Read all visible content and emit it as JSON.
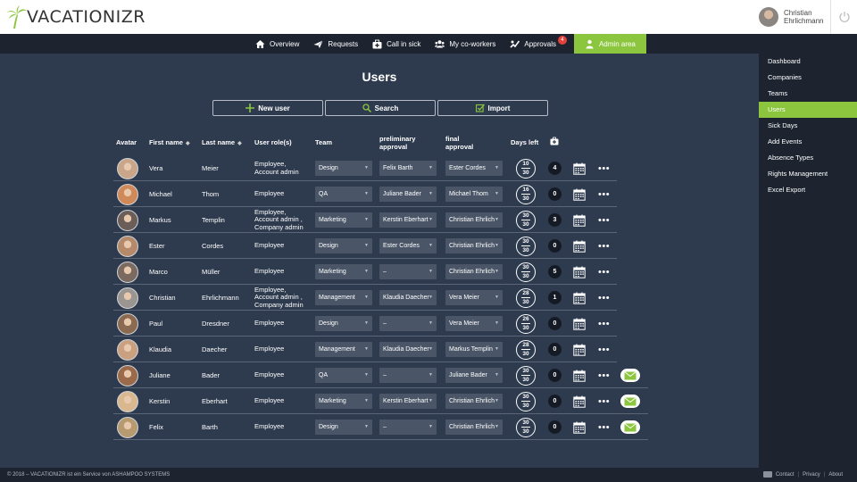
{
  "app": {
    "logo_text": "VACATIONIZR"
  },
  "user": {
    "name_line1": "Christian",
    "name_line2": "Ehrlichmann"
  },
  "nav": {
    "items": [
      {
        "label": "Overview",
        "icon": "home-icon"
      },
      {
        "label": "Requests",
        "icon": "plane-icon"
      },
      {
        "label": "Call in sick",
        "icon": "medkit-icon"
      },
      {
        "label": "My co-workers",
        "icon": "users-icon"
      },
      {
        "label": "Approvals",
        "icon": "approvals-icon",
        "badge": "4"
      },
      {
        "label": "Admin area",
        "icon": "admin-icon",
        "active": true
      }
    ]
  },
  "sidebar": {
    "items": [
      {
        "label": "Dashboard"
      },
      {
        "label": "Companies"
      },
      {
        "label": "Teams"
      },
      {
        "label": "Users",
        "active": true
      },
      {
        "label": "Sick Days"
      },
      {
        "label": "Add Events"
      },
      {
        "label": "Absence Types"
      },
      {
        "label": "Rights Management"
      },
      {
        "label": "Excel Export"
      }
    ]
  },
  "main": {
    "title": "Users",
    "actions": {
      "new_user": "New user",
      "search": "Search",
      "import": "Import"
    }
  },
  "table": {
    "headers": {
      "avatar": "Avatar",
      "first_name": "First name",
      "last_name": "Last name",
      "roles": "User role(s)",
      "team": "Team",
      "preliminary_1": "preliminary",
      "preliminary_2": "approval",
      "final_1": "final",
      "final_2": "approval",
      "days_left": "Days left"
    },
    "rows": [
      {
        "first": "Vera",
        "last": "Meier",
        "roles": [
          "Employee,",
          "Account admin"
        ],
        "team": "Design",
        "prelim": "Felix Barth",
        "final": "Ester Cordes",
        "days_left": "10",
        "days_total": "30",
        "sick": "4",
        "mail": false,
        "avatar_color": "#c9a58a"
      },
      {
        "first": "Michael",
        "last": "Thom",
        "roles": [
          "Employee"
        ],
        "team": "QA",
        "prelim": "Juliane Bader",
        "final": "Michael Thom",
        "days_left": "16",
        "days_total": "30",
        "sick": "0",
        "mail": false,
        "avatar_color": "#d08a5a"
      },
      {
        "first": "Markus",
        "last": "Templin",
        "roles": [
          "Employee,",
          "Account admin ,",
          "Company admin"
        ],
        "team": "Marketing",
        "prelim": "Kerstin Eberhart",
        "final": "Christian Ehrlich",
        "days_left": "30",
        "days_total": "30",
        "sick": "3",
        "mail": false,
        "avatar_color": "#6b5e58"
      },
      {
        "first": "Ester",
        "last": "Cordes",
        "roles": [
          "Employee"
        ],
        "team": "Design",
        "prelim": "Ester Cordes",
        "final": "Christian Ehrlich",
        "days_left": "30",
        "days_total": "30",
        "sick": "0",
        "mail": false,
        "avatar_color": "#b58a6a"
      },
      {
        "first": "Marco",
        "last": "Müller",
        "roles": [
          "Employee"
        ],
        "team": "Marketing",
        "prelim": "–",
        "final": "Christian Ehrlich",
        "days_left": "30",
        "days_total": "30",
        "sick": "5",
        "mail": false,
        "avatar_color": "#7a6a60"
      },
      {
        "first": "Christian",
        "last": "Ehrlichmann",
        "roles": [
          "Employee,",
          "Account admin ,",
          "Company admin"
        ],
        "team": "Management",
        "prelim": "Klaudia Daecher",
        "final": "Vera Meier",
        "days_left": "28",
        "days_total": "30",
        "sick": "1",
        "mail": false,
        "avatar_color": "#9a9590"
      },
      {
        "first": "Paul",
        "last": "Dresdner",
        "roles": [
          "Employee"
        ],
        "team": "Design",
        "prelim": "–",
        "final": "Vera Meier",
        "days_left": "26",
        "days_total": "30",
        "sick": "0",
        "mail": false,
        "avatar_color": "#8a6a50"
      },
      {
        "first": "Klaudia",
        "last": "Daecher",
        "roles": [
          "Employee"
        ],
        "team": "Management",
        "prelim": "Klaudia Daecher",
        "final": "Markus Templin",
        "days_left": "28",
        "days_total": "30",
        "sick": "0",
        "mail": false,
        "avatar_color": "#c9a080"
      },
      {
        "first": "Juliane",
        "last": "Bader",
        "roles": [
          "Employee"
        ],
        "team": "QA",
        "prelim": "–",
        "final": "Juliane Bader",
        "days_left": "30",
        "days_total": "30",
        "sick": "0",
        "mail": true,
        "avatar_color": "#9a6a4a"
      },
      {
        "first": "Kerstin",
        "last": "Eberhart",
        "roles": [
          "Employee"
        ],
        "team": "Marketing",
        "prelim": "Kerstin Eberhart",
        "final": "Christian Ehrlich",
        "days_left": "30",
        "days_total": "30",
        "sick": "0",
        "mail": true,
        "avatar_color": "#d9b890"
      },
      {
        "first": "Felix",
        "last": "Barth",
        "roles": [
          "Employee"
        ],
        "team": "Design",
        "prelim": "–",
        "final": "Christian Ehrlich",
        "days_left": "30",
        "days_total": "30",
        "sick": "0",
        "mail": true,
        "avatar_color": "#b89a70"
      }
    ]
  },
  "footer": {
    "copyright": "© 2018 – VACATIONIZR ist ein Service von ASHAMPOO SYSTEMS",
    "contact": "Contact",
    "privacy": "Privacy",
    "about": "About"
  },
  "colors": {
    "accent": "#8cc63f",
    "bg": "#2e3b4e",
    "dark": "#1d2430",
    "badge": "#e5403a"
  }
}
